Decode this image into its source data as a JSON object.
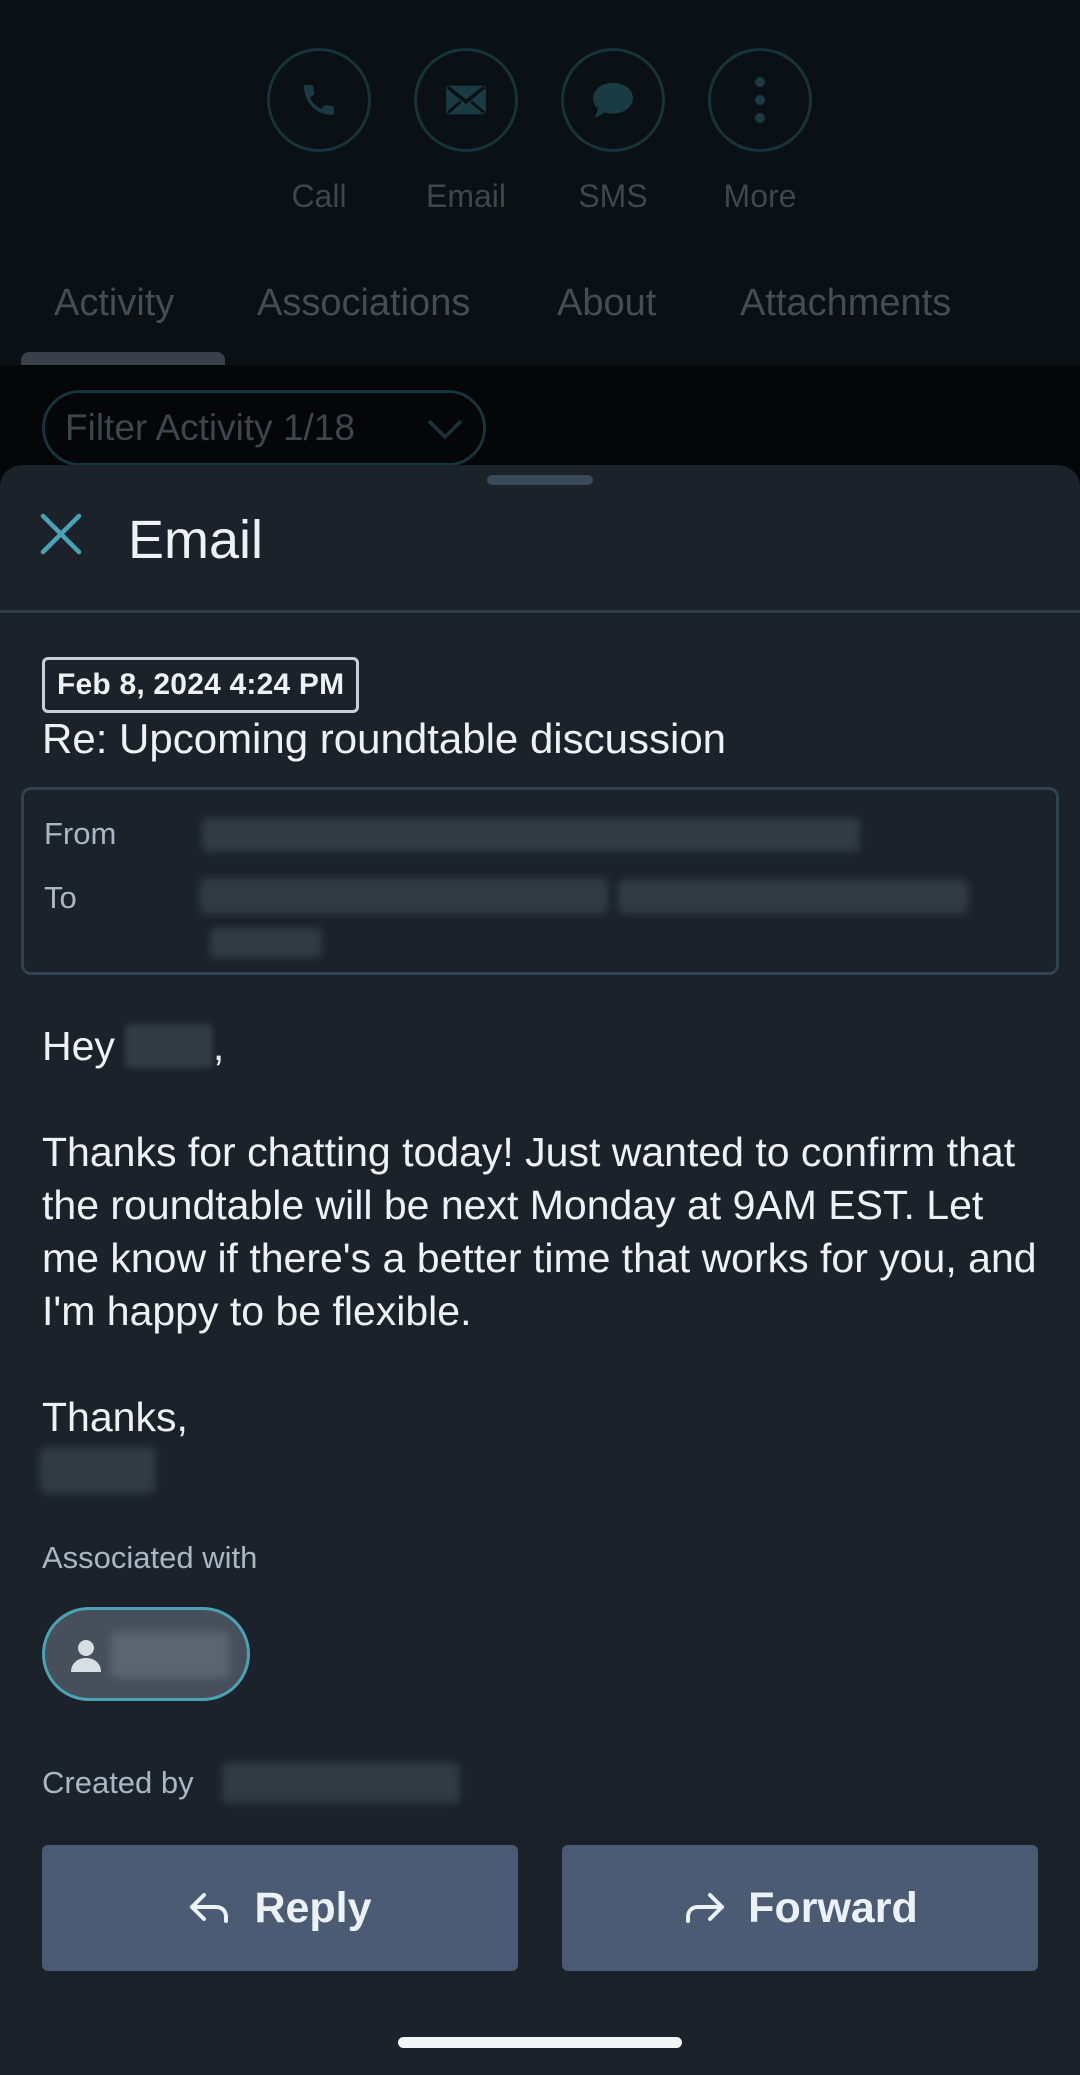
{
  "quick_actions": [
    {
      "label": "Call",
      "icon": "phone-icon"
    },
    {
      "label": "Email",
      "icon": "envelope-icon"
    },
    {
      "label": "SMS",
      "icon": "chat-bubble-icon"
    },
    {
      "label": "More",
      "icon": "more-vertical-icon"
    }
  ],
  "tabs": [
    {
      "label": "Activity",
      "active": true
    },
    {
      "label": "Associations",
      "active": false
    },
    {
      "label": "About",
      "active": false
    },
    {
      "label": "Attachments",
      "active": false
    }
  ],
  "filter": {
    "label": "Filter Activity 1/18"
  },
  "sheet": {
    "title": "Email",
    "date": "Feb 8, 2024 4:24 PM",
    "subject": "Re: Upcoming roundtable discussion",
    "from_label": "From",
    "to_label": "To",
    "greeting_prefix": "Hey",
    "greeting_suffix": ",",
    "body": "Thanks for chatting today! Just wanted to confirm that the roundtable will be next Monday at 9AM EST. Let me know if there's a better time that works for you, and I'm happy to be flexible.",
    "signoff": "Thanks,",
    "associated_label": "Associated with",
    "created_label": "Created by",
    "reply_label": "Reply",
    "forward_label": "Forward"
  },
  "colors": {
    "accent": "#4aa3b5",
    "sheet_bg": "#1b222a",
    "button_bg": "#4a5b73"
  }
}
